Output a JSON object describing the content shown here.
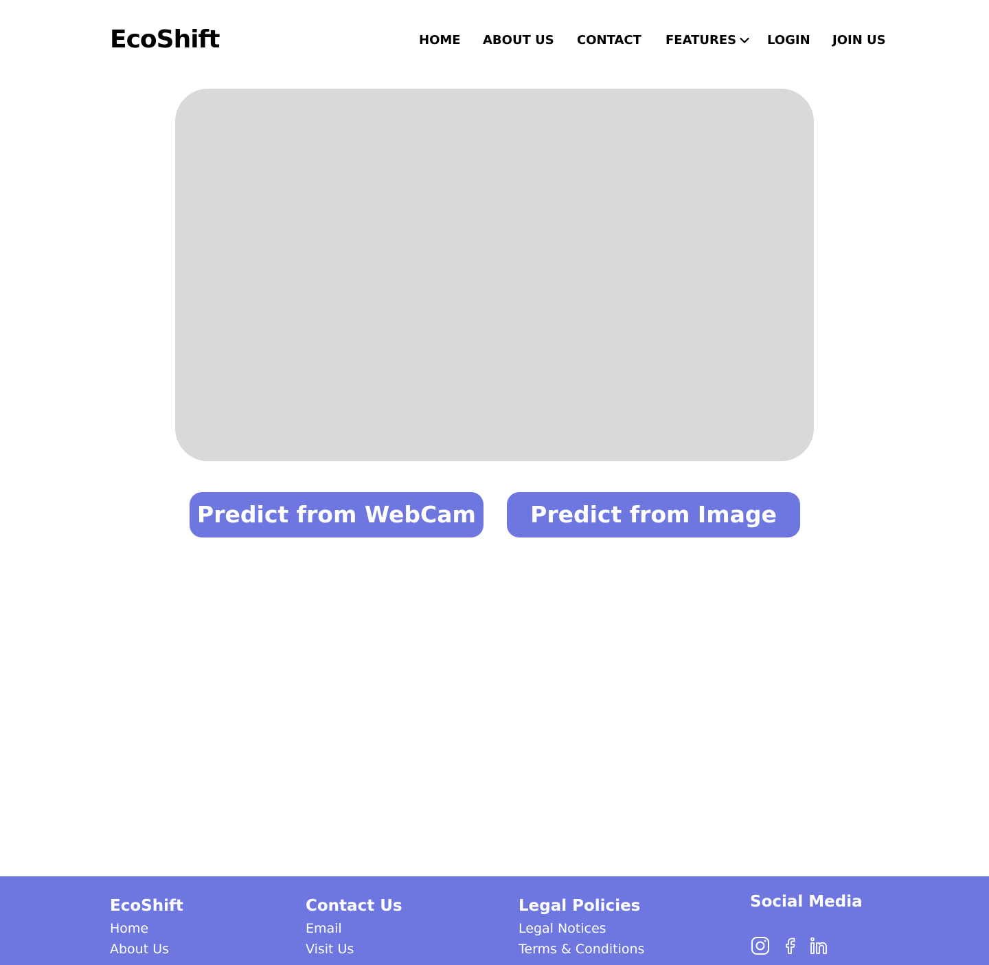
{
  "header": {
    "logo": "EcoShift",
    "nav": {
      "home": "HOME",
      "about": "ABOUT US",
      "contact": "CONTACT",
      "features": "FEATURES",
      "login": "LOGIN",
      "join": "JOIN US"
    }
  },
  "main": {
    "buttons": {
      "webcam": "Predict from WebCam",
      "image": "Predict from Image"
    }
  },
  "footer": {
    "brand": {
      "heading": "EcoShift",
      "links": [
        "Home",
        "About Us"
      ]
    },
    "contact": {
      "heading": "Contact Us",
      "links": [
        "Email",
        "Visit Us"
      ]
    },
    "legal": {
      "heading": "Legal Policies",
      "links": [
        "Legal Notices",
        "Terms & Conditions"
      ]
    },
    "social": {
      "heading": "Social Media",
      "icons": [
        "instagram-icon",
        "facebook-icon",
        "linkedin-icon"
      ]
    }
  },
  "colors": {
    "accent": "#6e77e0",
    "preview_bg": "#d9d9d9",
    "text": "#000000",
    "background": "#ffffff"
  }
}
